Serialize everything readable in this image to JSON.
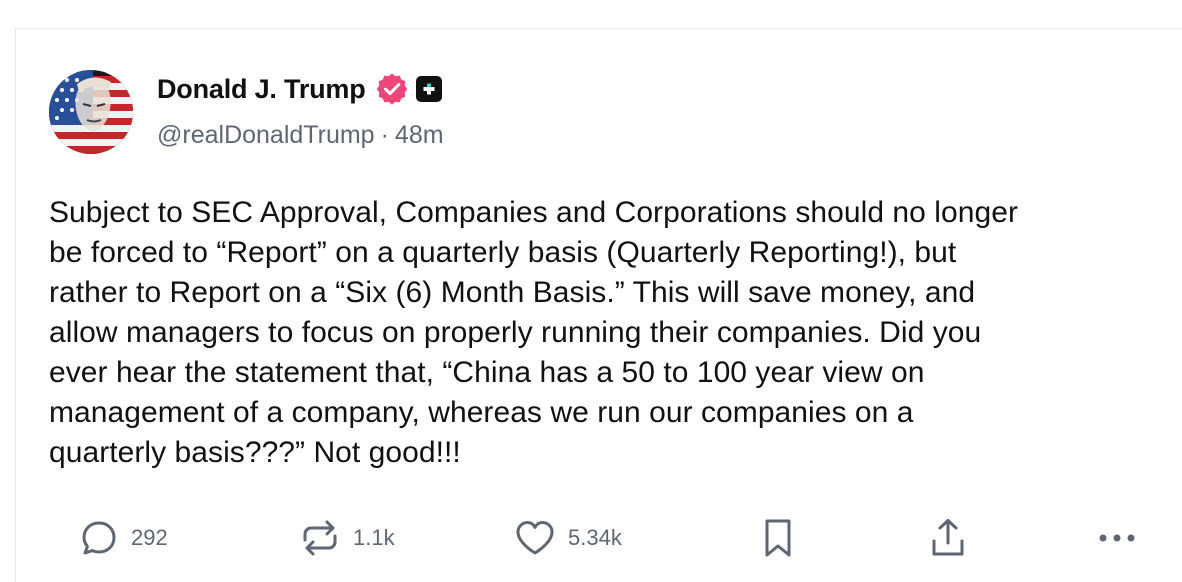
{
  "post": {
    "author": {
      "display_name": "Donald J. Trump",
      "handle": "@realDonaldTrump",
      "timestamp": "48m",
      "verified_badge_icon": "verified-badge-icon",
      "plus_badge_icon": "plus-badge-icon"
    },
    "separator": "·",
    "text": "Subject to SEC Approval, Companies and Corporations should no longer\nbe forced to “Report” on a quarterly basis (Quarterly Reporting!), but\nrather to Report on a “Six (6) Month Basis.” This will save money, and\nallow managers to focus on properly running their companies. Did you\never hear the statement that, “China has a 50 to 100 year view on\nmanagement of a company, whereas we run our companies on a\nquarterly basis???” Not good!!!",
    "actions": {
      "replies": "292",
      "reposts": "1.1k",
      "likes": "5.34k"
    }
  },
  "icons": {
    "reply": "reply-icon",
    "repost": "repost-icon",
    "like": "heart-icon",
    "bookmark": "bookmark-icon",
    "share": "share-icon",
    "more": "more-icon"
  },
  "colors": {
    "text": "#111111",
    "muted": "#5f6672",
    "verified": "#f0457a",
    "border": "#e6e6e6"
  }
}
